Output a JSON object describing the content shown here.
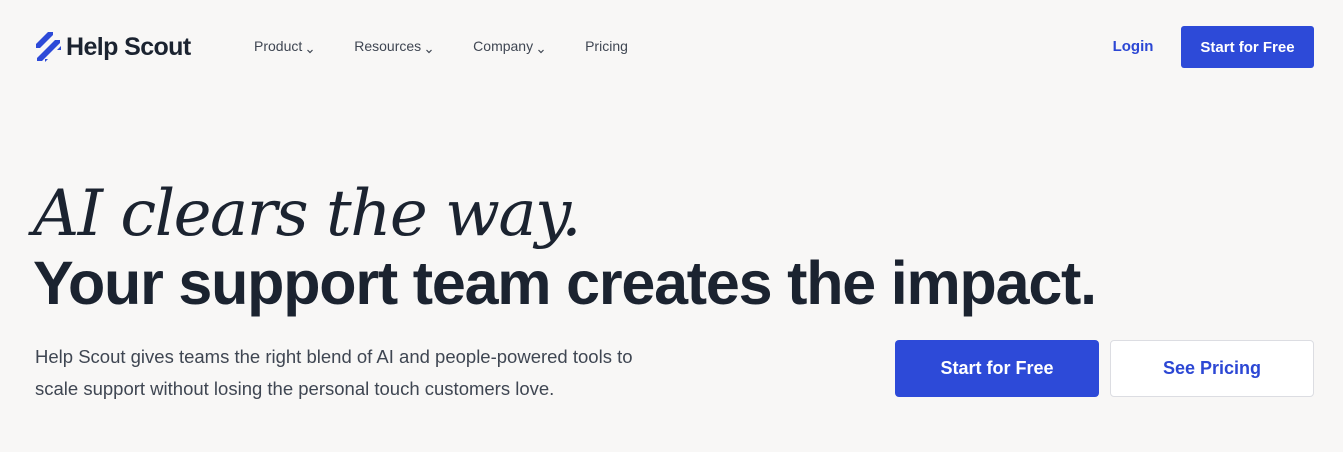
{
  "brand": {
    "name": "Help Scout",
    "accent_color": "#2d4ad8",
    "text_color": "#1b2330",
    "background_color": "#f8f7f6"
  },
  "nav": {
    "items": [
      {
        "label": "Product",
        "has_dropdown": true
      },
      {
        "label": "Resources",
        "has_dropdown": true
      },
      {
        "label": "Company",
        "has_dropdown": true
      },
      {
        "label": "Pricing",
        "has_dropdown": false
      }
    ],
    "login_label": "Login",
    "cta_label": "Start for Free"
  },
  "hero": {
    "headline_italic": "AI clears the way.",
    "headline_bold": "Your support team creates the impact.",
    "subtext": "Help Scout gives teams the right blend of AI and people-powered tools to scale support without losing the personal touch customers love.",
    "primary_cta": "Start for Free",
    "secondary_cta": "See Pricing"
  },
  "icons": {
    "logo": "help-scout-logo-icon",
    "dropdown": "chevron-down-icon"
  }
}
